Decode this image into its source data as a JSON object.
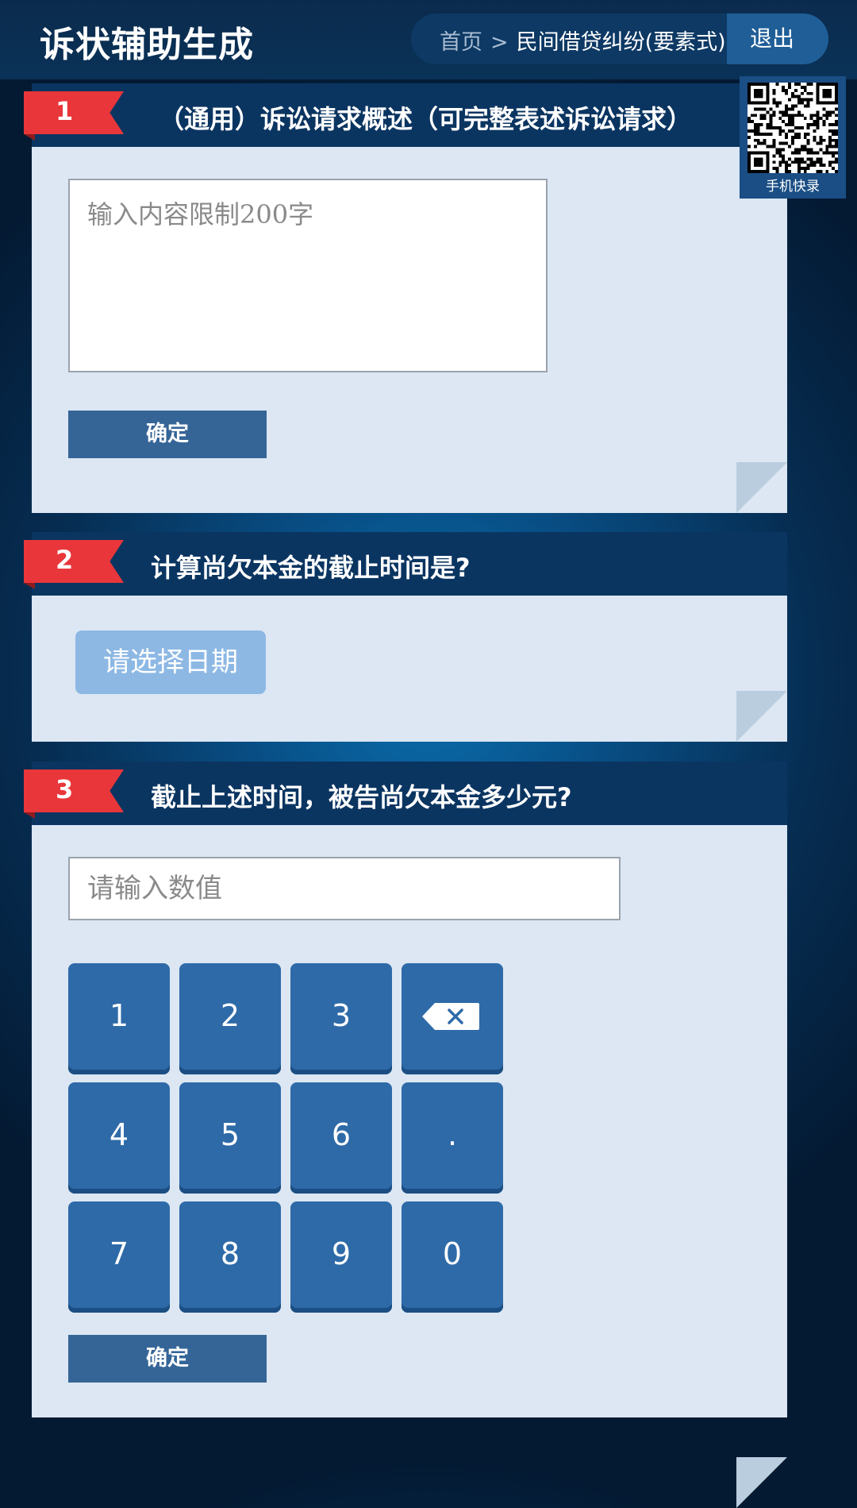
{
  "header": {
    "title": "诉状辅助生成",
    "breadcrumb": {
      "home": "首页",
      "separator": ">",
      "current": "民间借贷纠纷(要素式)"
    },
    "logout_label": "退出"
  },
  "qr": {
    "label": "手机快录"
  },
  "sections": [
    {
      "number": "1",
      "title": "（通用）诉讼请求概述（可完整表述诉讼请求）",
      "input_placeholder": "输入内容限制200字",
      "input_value": "",
      "confirm_label": "确定"
    },
    {
      "number": "2",
      "title": "计算尚欠本金的截止时间是?",
      "date_button_label": "请选择日期"
    },
    {
      "number": "3",
      "title": "截止上述时间，被告尚欠本金多少元?",
      "input_placeholder": "请输入数值",
      "input_value": "",
      "keypad": [
        "1",
        "2",
        "3",
        "backspace",
        "4",
        "5",
        "6",
        ".",
        "7",
        "8",
        "9",
        "0"
      ],
      "confirm_label": "确定"
    }
  ],
  "colors": {
    "header_bg": "#0b2b4d",
    "section_header": "#0b3561",
    "section_body": "#dce7f3",
    "badge_red": "#e9363a",
    "key_blue": "#2e6aa8",
    "confirm_blue": "#356597",
    "date_button": "#8db8e4"
  },
  "icons": {
    "backspace": "backspace-icon",
    "qr": "qr-code-icon"
  }
}
